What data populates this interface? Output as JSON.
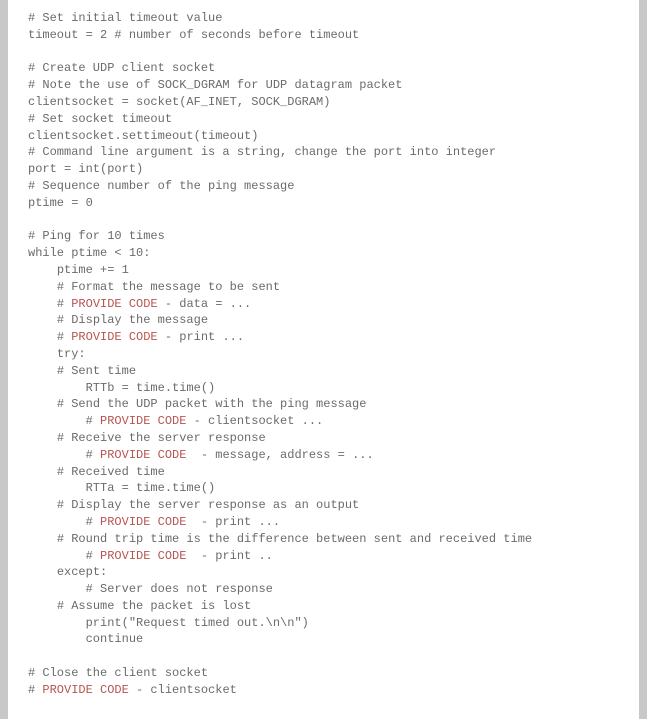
{
  "lines": [
    {
      "indent": 0,
      "segments": [
        {
          "t": "plain",
          "v": "# Set initial timeout value"
        }
      ]
    },
    {
      "indent": 0,
      "segments": [
        {
          "t": "plain",
          "v": "timeout = 2 # number of seconds before timeout"
        }
      ]
    },
    {
      "indent": 0,
      "segments": [
        {
          "t": "plain",
          "v": ""
        }
      ]
    },
    {
      "indent": 0,
      "segments": [
        {
          "t": "plain",
          "v": "# Create UDP client socket"
        }
      ]
    },
    {
      "indent": 0,
      "segments": [
        {
          "t": "plain",
          "v": "# Note the use of SOCK_DGRAM for UDP datagram packet"
        }
      ]
    },
    {
      "indent": 0,
      "segments": [
        {
          "t": "plain",
          "v": "clientsocket = socket(AF_INET, SOCK_DGRAM)"
        }
      ]
    },
    {
      "indent": 0,
      "segments": [
        {
          "t": "plain",
          "v": "# Set socket timeout"
        }
      ]
    },
    {
      "indent": 0,
      "segments": [
        {
          "t": "plain",
          "v": "clientsocket.settimeout(timeout)"
        }
      ]
    },
    {
      "indent": 0,
      "segments": [
        {
          "t": "plain",
          "v": "# Command line argument is a string, change the port into integer"
        }
      ]
    },
    {
      "indent": 0,
      "segments": [
        {
          "t": "plain",
          "v": "port = int(port)"
        }
      ]
    },
    {
      "indent": 0,
      "segments": [
        {
          "t": "plain",
          "v": "# Sequence number of the ping message"
        }
      ]
    },
    {
      "indent": 0,
      "segments": [
        {
          "t": "plain",
          "v": "ptime = 0"
        }
      ]
    },
    {
      "indent": 0,
      "segments": [
        {
          "t": "plain",
          "v": ""
        }
      ]
    },
    {
      "indent": 0,
      "segments": [
        {
          "t": "plain",
          "v": "# Ping for 10 times"
        }
      ]
    },
    {
      "indent": 0,
      "segments": [
        {
          "t": "plain",
          "v": "while ptime < 10:"
        }
      ]
    },
    {
      "indent": 1,
      "segments": [
        {
          "t": "plain",
          "v": "ptime += 1"
        }
      ]
    },
    {
      "indent": 1,
      "segments": [
        {
          "t": "plain",
          "v": "# Format the message to be sent"
        }
      ]
    },
    {
      "indent": 1,
      "segments": [
        {
          "t": "plain",
          "v": "# "
        },
        {
          "t": "provide",
          "v": "PROVIDE CODE"
        },
        {
          "t": "plain",
          "v": " - data = ..."
        }
      ]
    },
    {
      "indent": 1,
      "segments": [
        {
          "t": "plain",
          "v": "# Display the message"
        }
      ]
    },
    {
      "indent": 1,
      "segments": [
        {
          "t": "plain",
          "v": "# "
        },
        {
          "t": "provide",
          "v": "PROVIDE CODE"
        },
        {
          "t": "plain",
          "v": " - print ..."
        }
      ]
    },
    {
      "indent": 1,
      "segments": [
        {
          "t": "plain",
          "v": "try:"
        }
      ]
    },
    {
      "indent": 1,
      "segments": [
        {
          "t": "plain",
          "v": "# Sent time"
        }
      ]
    },
    {
      "indent": 2,
      "segments": [
        {
          "t": "plain",
          "v": "RTTb = time.time()"
        }
      ]
    },
    {
      "indent": 1,
      "segments": [
        {
          "t": "plain",
          "v": "# Send the UDP packet with the ping message"
        }
      ]
    },
    {
      "indent": 2,
      "segments": [
        {
          "t": "plain",
          "v": "# "
        },
        {
          "t": "provide",
          "v": "PROVIDE CODE"
        },
        {
          "t": "plain",
          "v": " - clientsocket ..."
        }
      ]
    },
    {
      "indent": 1,
      "segments": [
        {
          "t": "plain",
          "v": "# Receive the server response"
        }
      ]
    },
    {
      "indent": 2,
      "segments": [
        {
          "t": "plain",
          "v": "# "
        },
        {
          "t": "provide",
          "v": "PROVIDE CODE"
        },
        {
          "t": "plain",
          "v": "  - message, address = ..."
        }
      ]
    },
    {
      "indent": 1,
      "segments": [
        {
          "t": "plain",
          "v": "# Received time"
        }
      ]
    },
    {
      "indent": 2,
      "segments": [
        {
          "t": "plain",
          "v": "RTTa = time.time()"
        }
      ]
    },
    {
      "indent": 1,
      "segments": [
        {
          "t": "plain",
          "v": "# Display the server response as an output"
        }
      ]
    },
    {
      "indent": 2,
      "segments": [
        {
          "t": "plain",
          "v": "# "
        },
        {
          "t": "provide",
          "v": "PROVIDE CODE"
        },
        {
          "t": "plain",
          "v": "  - print ..."
        }
      ]
    },
    {
      "indent": 1,
      "segments": [
        {
          "t": "plain",
          "v": "# Round trip time is the difference between sent and received time"
        }
      ]
    },
    {
      "indent": 2,
      "segments": [
        {
          "t": "plain",
          "v": "# "
        },
        {
          "t": "provide",
          "v": "PROVIDE CODE"
        },
        {
          "t": "plain",
          "v": "  - print .."
        }
      ]
    },
    {
      "indent": 1,
      "segments": [
        {
          "t": "plain",
          "v": "except:"
        }
      ]
    },
    {
      "indent": 2,
      "segments": [
        {
          "t": "plain",
          "v": "# Server does not response"
        }
      ]
    },
    {
      "indent": 1,
      "segments": [
        {
          "t": "plain",
          "v": "# Assume the packet is lost"
        }
      ]
    },
    {
      "indent": 2,
      "segments": [
        {
          "t": "plain",
          "v": "print(\"Request timed out.\\n\\n\")"
        }
      ]
    },
    {
      "indent": 2,
      "segments": [
        {
          "t": "plain",
          "v": "continue"
        }
      ]
    },
    {
      "indent": 0,
      "segments": [
        {
          "t": "plain",
          "v": ""
        }
      ]
    },
    {
      "indent": 0,
      "segments": [
        {
          "t": "plain",
          "v": "# Close the client socket"
        }
      ]
    },
    {
      "indent": 0,
      "segments": [
        {
          "t": "plain",
          "v": "# "
        },
        {
          "t": "provide",
          "v": "PROVIDE CODE"
        },
        {
          "t": "plain",
          "v": " - clientsocket"
        }
      ]
    }
  ],
  "indent_unit": "    "
}
